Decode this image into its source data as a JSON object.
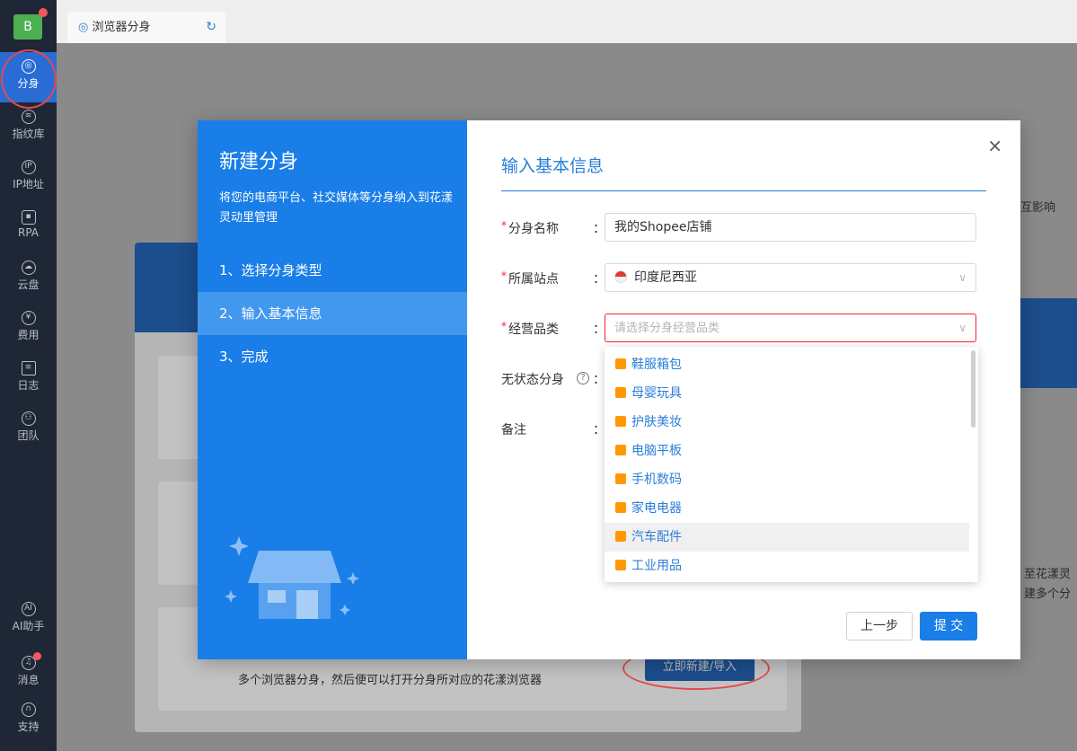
{
  "sidebar": {
    "avatar_letter": "B",
    "items": [
      {
        "label": "分身",
        "icon": "chrome-icon"
      },
      {
        "label": "指纹库",
        "icon": "fingerprint-icon"
      },
      {
        "label": "IP地址",
        "icon": "ip-icon"
      },
      {
        "label": "RPA",
        "icon": "robot-icon"
      },
      {
        "label": "云盘",
        "icon": "cloud-icon"
      },
      {
        "label": "费用",
        "icon": "yen-icon"
      },
      {
        "label": "日志",
        "icon": "document-icon"
      },
      {
        "label": "团队",
        "icon": "team-icon"
      }
    ],
    "bottom": [
      {
        "label": "AI助手",
        "icon": "ai-icon"
      },
      {
        "label": "消息",
        "icon": "bell-icon"
      },
      {
        "label": "支持",
        "icon": "headset-icon"
      }
    ]
  },
  "tab": {
    "label": "浏览器分身"
  },
  "background": {
    "right_text_1": "互影响",
    "right_text_2": "至花漾灵",
    "right_text_3": "建多个分",
    "bottom_text": "多个浏览器分身，然后便可以打开分身所对应的花漾浏览器",
    "button": "立即新建/导入"
  },
  "dialog": {
    "title": "新建分身",
    "description": "将您的电商平台、社交媒体等分身纳入到花漾灵动里管理",
    "steps": [
      "1、选择分身类型",
      "2、输入基本信息",
      "3、完成"
    ],
    "section_title": "输入基本信息",
    "close": "×",
    "form": {
      "name_label": "分身名称",
      "name_value": "我的Shopee店铺",
      "site_label": "所属站点",
      "site_value": "印度尼西亚",
      "category_label": "经营品类",
      "category_placeholder": "请选择分身经营品类",
      "stateless_label": "无状态分身",
      "remark_label": "备注",
      "colon": "："
    },
    "categories": [
      "鞋服箱包",
      "母婴玩具",
      "护肤美妆",
      "电脑平板",
      "手机数码",
      "家电电器",
      "汽车配件",
      "工业用品"
    ],
    "buttons": {
      "prev": "上一步",
      "submit": "提 交"
    }
  },
  "colors": {
    "primary": "#1a7ee8",
    "sidebar": "#1f2636",
    "accent": "#ff9800",
    "error": "#f5222d"
  }
}
